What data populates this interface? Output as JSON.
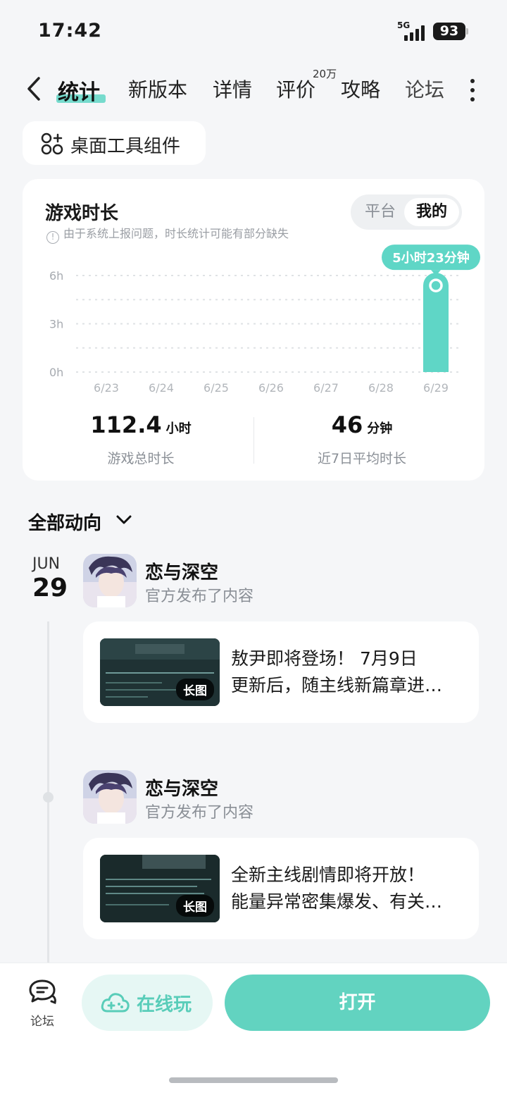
{
  "status_bar": {
    "time": "17:42",
    "network": "5G",
    "battery": "93"
  },
  "nav": {
    "tabs": [
      {
        "label": "统计",
        "active": true
      },
      {
        "label": "新版本"
      },
      {
        "label": "详情"
      },
      {
        "label": "评价",
        "badge": "20万"
      },
      {
        "label": "攻略"
      },
      {
        "label": "论坛"
      }
    ]
  },
  "widget_chip": {
    "label": "桌面工具组件"
  },
  "stats": {
    "title": "游戏时长",
    "note": "由于系统上报问题，时长统计可能有部分缺失",
    "toggle": {
      "options": [
        "平台",
        "我的"
      ],
      "selected": "我的"
    },
    "total": {
      "value": "112.4",
      "unit": "小时",
      "label": "游戏总时长"
    },
    "average": {
      "value": "46",
      "unit": "分钟",
      "label": "近7日平均时长"
    }
  },
  "chart_data": {
    "type": "bar",
    "categories": [
      "6/23",
      "6/24",
      "6/25",
      "6/26",
      "6/27",
      "6/28",
      "6/29"
    ],
    "values": [
      0,
      0,
      0,
      0,
      0,
      0,
      5.38
    ],
    "y_ticks": [
      "0h",
      "3h",
      "6h"
    ],
    "ylim": [
      0,
      6
    ],
    "highlight_label": "5小时23分钟",
    "grid": true,
    "accent_color": "#5fd6c6"
  },
  "feed": {
    "filter_label": "全部动向",
    "date_month": "JUN",
    "date_day": "29",
    "posts": [
      {
        "author": "恋与深空",
        "subtitle": "官方发布了内容",
        "thumb_badge": "长图",
        "text_line1": "敖尹即将登场！ 7月9日",
        "text_line2": "更新后，随主线新篇章进…"
      },
      {
        "author": "恋与深空",
        "subtitle": "官方发布了内容",
        "thumb_badge": "长图",
        "text_line1": "全新主线剧情即将开放！",
        "text_line2": "能量异常密集爆发、有关…"
      }
    ]
  },
  "bottom_bar": {
    "forum_label": "论坛",
    "play_online_label": "在线玩",
    "open_label": "打开"
  },
  "colors": {
    "accent": "#62d3c0",
    "accent_light": "#e6f7f4",
    "background": "#f5f6f8"
  }
}
